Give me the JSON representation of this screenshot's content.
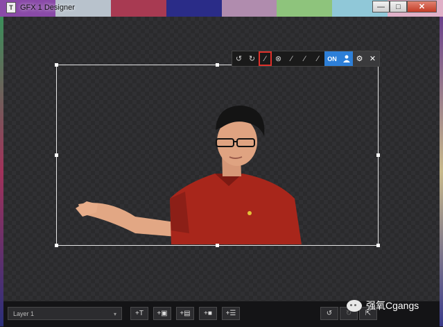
{
  "window": {
    "title": "GFX 1 Designer",
    "icon_letter": "T",
    "minimize": "—",
    "maximize": "□",
    "close": "✕"
  },
  "toolbar": {
    "undo": "↺",
    "redo": "↻",
    "magic_wand_active": "⁄",
    "remove_circle": "⊗",
    "pick_1": "⁄",
    "pick_2": "⁄",
    "pick_3": "⁄",
    "on_label": "ON",
    "person_icon": "person-icon",
    "settings": "⚙",
    "close": "✕"
  },
  "bottom": {
    "layer_select": "Layer 1",
    "layer_arrow": "▾",
    "add_text": "+T",
    "add_image": "+▣",
    "add_slides": "+▤",
    "add_video": "+■",
    "add_list": "+☰",
    "undo": "↺",
    "redo": "↻",
    "resize": "⇱"
  },
  "watermark": {
    "text": "强氧Cgangs"
  },
  "colors": {
    "accent": "#2d7fd8",
    "active_border": "#e0302a",
    "background": "#1d1d1f"
  }
}
